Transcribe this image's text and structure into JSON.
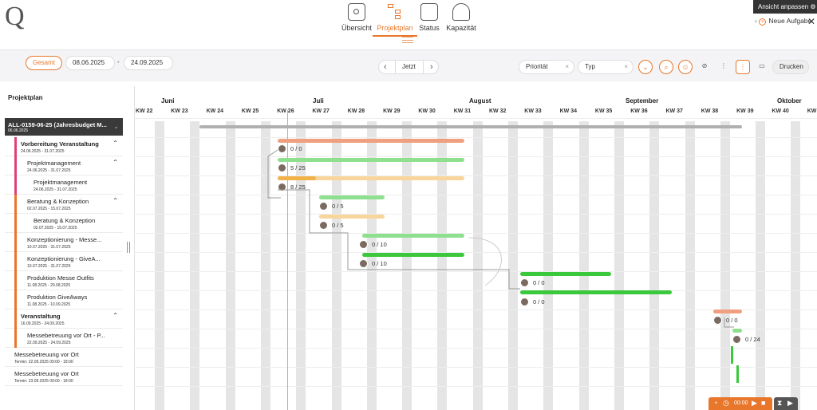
{
  "app": {
    "logo": "Q"
  },
  "nav": {
    "items": [
      {
        "label": "Übersicht",
        "icon": "eye-icon"
      },
      {
        "label": "Projektplan",
        "icon": "hierarchy-icon"
      },
      {
        "label": "Status",
        "icon": "flow-icon"
      },
      {
        "label": "Kapazität",
        "icon": "people-icon"
      }
    ],
    "active": "Projektplan"
  },
  "topright": {
    "ansicht": "Ansicht anpassen",
    "neue_aufgabe": "Neue Aufgabe"
  },
  "toolbar": {
    "gesamt": "Gesamt",
    "date_from": "08.06.2025",
    "date_sep": "-",
    "date_to": "24.09.2025",
    "jetzt": "Jetzt",
    "filter_prioritaet": "Priorität",
    "filter_typ": "Typ",
    "drucken": "Drucken"
  },
  "panel": {
    "title": "Projektplan"
  },
  "root": {
    "title": "ALL-0159-06-25 (Jahresbudget M...",
    "date": "06.06.2025"
  },
  "rows": [
    {
      "title": "Vorbereitung Veranstaltung",
      "date": "24.06.2025 - 31.07.2025",
      "bold": true
    },
    {
      "title": "Projektmanagement",
      "date": "24.06.2025 - 31.07.2025"
    },
    {
      "title": "Projektmanagement",
      "date": "24.06.2025 - 31.07.2025"
    },
    {
      "title": "Beratung & Konzeption",
      "date": "02.07.2025 - 15.07.2025"
    },
    {
      "title": "Beratung & Konzeption",
      "date": "02.07.2025 - 15.07.2025"
    },
    {
      "title": "Konzeptionierung - Messe...",
      "date": "10.07.2025 - 31.07.2025"
    },
    {
      "title": "Konzeptionierung - GiveA...",
      "date": "10.07.2025 - 31.07.2025"
    },
    {
      "title": "Produktion Messe Outfits",
      "date": "11.08.2025 - 29.08.2025"
    },
    {
      "title": "Produktion GiveAways",
      "date": "11.08.2025 - 10.09.2025"
    },
    {
      "title": "Veranstaltung",
      "date": "16.09.2025 - 24.09.2025",
      "bold": true
    },
    {
      "title": "Messebetreuung vor Ort - P...",
      "date": "22.09.2025 - 24.09.2025"
    },
    {
      "title": "Messebetreuung vor Ort",
      "date": "Termin: 22.09.2025 09:00 - 18:00"
    },
    {
      "title": "Messebetreuung vor Ort",
      "date": "Termin: 23.09.2025 09:00 - 18:00"
    }
  ],
  "months": [
    "Juni",
    "Juli",
    "August",
    "September",
    "Oktober"
  ],
  "weeks": [
    "KW 22",
    "KW 23",
    "KW 24",
    "KW 25",
    "KW 26",
    "KW 27",
    "KW 28",
    "KW 29",
    "KW 30",
    "KW 31",
    "KW 32",
    "KW 33",
    "KW 34",
    "KW 35",
    "KW 36",
    "KW 37",
    "KW 38",
    "KW 39",
    "KW 40",
    "KW"
  ],
  "bar_labels": [
    "0 / 0",
    "5 / 25",
    "8 / 25",
    "0 / 5",
    "0 / 5",
    "0 / 10",
    "0 / 10",
    "0 / 0",
    "0 / 0",
    "0 / 0",
    "0 / 24"
  ],
  "bottom": {
    "timer": "00:00"
  },
  "colors": {
    "accent": "#e8772b",
    "green": "#3cc83c",
    "lightgreen": "#8ee08e",
    "salmon": "#f0a080",
    "amber": "#f2b24a",
    "lightamber": "#f8d59a"
  }
}
